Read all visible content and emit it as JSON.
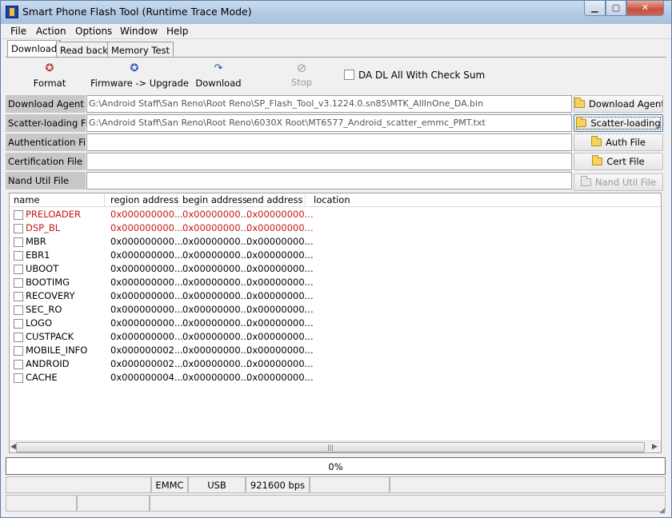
{
  "window": {
    "title": "Smart Phone Flash Tool (Runtime Trace Mode)"
  },
  "menu": [
    "File",
    "Action",
    "Options",
    "Window",
    "Help"
  ],
  "tabs": [
    "Download",
    "Read back",
    "Memory Test"
  ],
  "toolbar": {
    "format": "Format",
    "firmware_upgrade": "Firmware -> Upgrade",
    "download": "Download",
    "stop": "Stop",
    "da_checksum": "DA DL All With Check Sum"
  },
  "files": {
    "download_agent": {
      "label": "Download Agent",
      "value": "G:\\Android Staff\\San Reno\\Root Reno\\SP_Flash_Tool_v3.1224.0.sn85\\MTK_AllInOne_DA.bin",
      "button": "Download Agent"
    },
    "scatter": {
      "label": "Scatter-loading File",
      "value": "G:\\Android Staff\\San Reno\\Root Reno\\6030X Root\\MT6577_Android_scatter_emmc_PMT.txt",
      "button": "Scatter-loading"
    },
    "auth": {
      "label": "Authentication File",
      "value": "",
      "button": "Auth File"
    },
    "cert": {
      "label": "Certification File",
      "value": "",
      "button": "Cert File"
    },
    "nand": {
      "label": "Nand Util File",
      "value": "",
      "button": "Nand Util File"
    }
  },
  "table": {
    "columns": [
      "name",
      "region address",
      "begin address",
      "end address",
      "location"
    ],
    "rows": [
      {
        "name": "PRELOADER",
        "region": "0x000000000...",
        "begin": "0x00000000...",
        "end": "0x00000000...",
        "red": true
      },
      {
        "name": "DSP_BL",
        "region": "0x000000000...",
        "begin": "0x00000000...",
        "end": "0x00000000...",
        "red": true
      },
      {
        "name": "MBR",
        "region": "0x000000000...",
        "begin": "0x00000000...",
        "end": "0x00000000...",
        "red": false
      },
      {
        "name": "EBR1",
        "region": "0x000000000...",
        "begin": "0x00000000...",
        "end": "0x00000000...",
        "red": false
      },
      {
        "name": "UBOOT",
        "region": "0x000000000...",
        "begin": "0x00000000...",
        "end": "0x00000000...",
        "red": false
      },
      {
        "name": "BOOTIMG",
        "region": "0x000000000...",
        "begin": "0x00000000...",
        "end": "0x00000000...",
        "red": false
      },
      {
        "name": "RECOVERY",
        "region": "0x000000000...",
        "begin": "0x00000000...",
        "end": "0x00000000...",
        "red": false
      },
      {
        "name": "SEC_RO",
        "region": "0x000000000...",
        "begin": "0x00000000...",
        "end": "0x00000000...",
        "red": false
      },
      {
        "name": "LOGO",
        "region": "0x000000000...",
        "begin": "0x00000000...",
        "end": "0x00000000...",
        "red": false
      },
      {
        "name": "CUSTPACK",
        "region": "0x000000000...",
        "begin": "0x00000000...",
        "end": "0x00000000...",
        "red": false
      },
      {
        "name": "MOBILE_INFO",
        "region": "0x000000002...",
        "begin": "0x00000000...",
        "end": "0x00000000...",
        "red": false
      },
      {
        "name": "ANDROID",
        "region": "0x000000002...",
        "begin": "0x00000000...",
        "end": "0x00000000...",
        "red": false
      },
      {
        "name": "CACHE",
        "region": "0x000000004...",
        "begin": "0x00000000...",
        "end": "0x00000000...",
        "red": false
      }
    ]
  },
  "progress": {
    "text": "0%",
    "value": 0
  },
  "status": {
    "storage": "EMMC",
    "port": "USB",
    "baud": "921600 bps"
  },
  "icons": {
    "format": "format-icon",
    "firmware": "firmware-upgrade-icon",
    "download": "download-arrow-icon",
    "stop": "stop-icon",
    "folder": "folder-icon"
  },
  "colors": {
    "red_row": "#c01818",
    "title_bar": "#b4cae3",
    "close_button": "#c7503a"
  }
}
